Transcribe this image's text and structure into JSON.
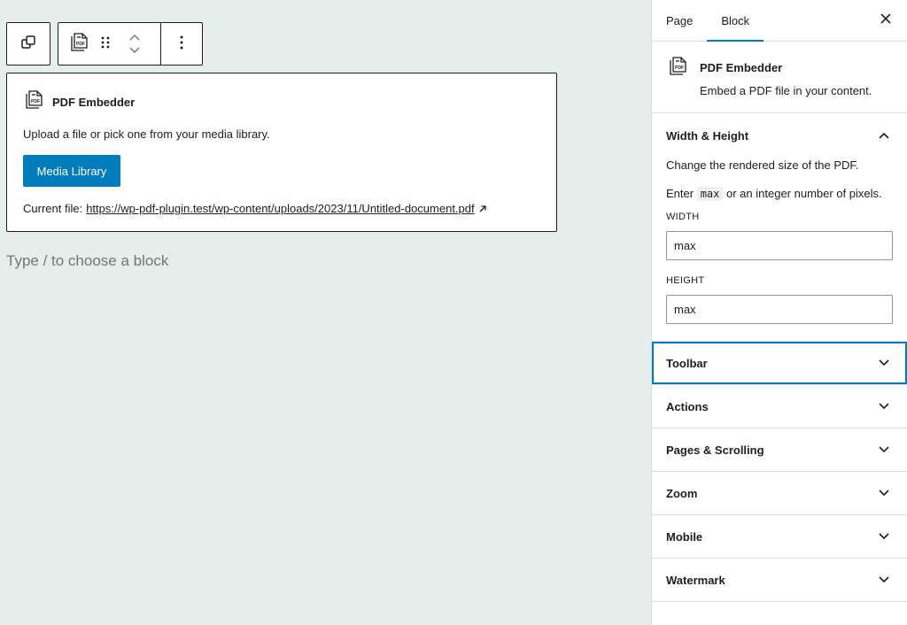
{
  "toolbar": {
    "transform_icon": "block-transform-icon",
    "pdf_icon": "pdf-file-icon",
    "drag_icon": "drag-handle-icon",
    "move_up_icon": "chevron-up-icon",
    "move_down_icon": "chevron-down-icon",
    "options_icon": "more-vertical-icon"
  },
  "block": {
    "title": "PDF Embedder",
    "instructions": "Upload a file or pick one from your media library.",
    "media_button": "Media Library",
    "current_file_label": "Current file:",
    "current_file_url": "https://wp-pdf-plugin.test/wp-content/uploads/2023/11/Untitled-document.pdf"
  },
  "canvas": {
    "placeholder": "Type / to choose a block"
  },
  "sidebar": {
    "tabs": [
      {
        "label": "Page",
        "active": false
      },
      {
        "label": "Block",
        "active": true
      }
    ],
    "card": {
      "title": "PDF Embedder",
      "description": "Embed a PDF file in your content."
    },
    "width_height": {
      "title": "Width & Height",
      "description": "Change the rendered size of the PDF.",
      "enter_prefix": "Enter",
      "enter_code": "max",
      "enter_suffix": "or an integer number of pixels.",
      "width_label": "WIDTH",
      "width_value": "max",
      "height_label": "HEIGHT",
      "height_value": "max"
    },
    "panels": [
      {
        "title": "Toolbar"
      },
      {
        "title": "Actions"
      },
      {
        "title": "Pages & Scrolling"
      },
      {
        "title": "Zoom"
      },
      {
        "title": "Mobile"
      },
      {
        "title": "Watermark"
      }
    ]
  },
  "colors": {
    "accent": "#007cba",
    "canvas_bg": "#e5eeea",
    "text": "#1e1e1e"
  }
}
